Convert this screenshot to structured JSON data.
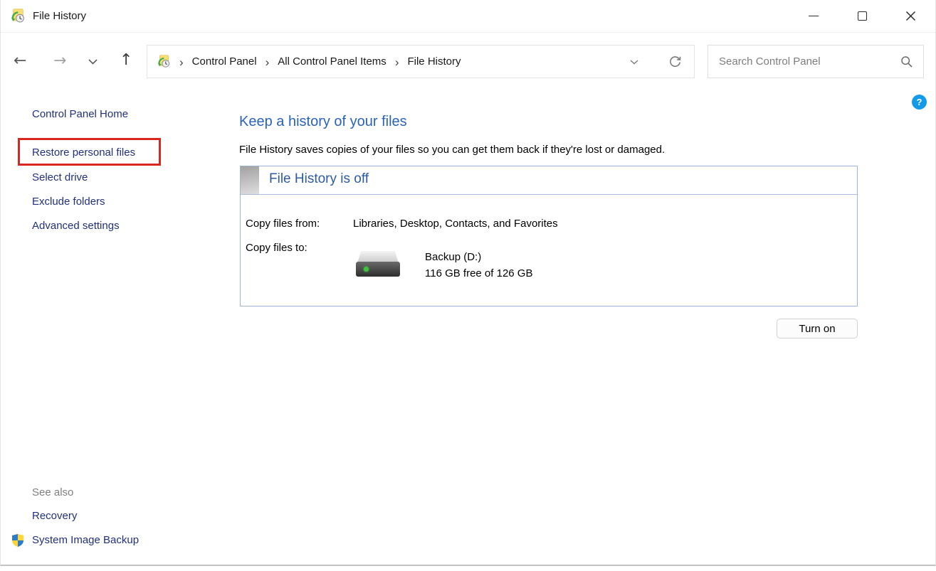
{
  "window": {
    "title": "File History"
  },
  "toolbar": {
    "back_icon": "←",
    "forward_icon": "→",
    "up_icon": "↑"
  },
  "breadcrumb": {
    "separator": "›",
    "items": [
      "Control Panel",
      "All Control Panel Items",
      "File History"
    ]
  },
  "search": {
    "placeholder": "Search Control Panel"
  },
  "sidebar": {
    "home_label": "Control Panel Home",
    "tasks": [
      "Restore personal files",
      "Select drive",
      "Exclude folders",
      "Advanced settings"
    ],
    "highlighted_task": "Restore personal files",
    "see_also_heading": "See also",
    "see_also_links": [
      "Recovery",
      "System Image Backup"
    ]
  },
  "main": {
    "heading": "Keep a history of your files",
    "description": "File History saves copies of your files so you can get them back if they're lost or damaged.",
    "panel": {
      "status_title": "File History is off",
      "copy_from_label": "Copy files from:",
      "copy_from_value": "Libraries, Desktop, Contacts, and Favorites",
      "copy_to_label": "Copy files to:",
      "drive_name": "Backup (D:)",
      "drive_free": "116 GB free of 126 GB"
    },
    "turn_on_label": "Turn on",
    "help_label": "?"
  },
  "colors": {
    "sidebar_link": "#21307e",
    "heading_blue": "#2a62c0",
    "panel_border": "#9db5d9",
    "panel_title_blue": "#2c5ba6",
    "annotation_red": "#d9261f",
    "help_blue": "#139ae8",
    "drive_led_green": "#3ec43e"
  }
}
